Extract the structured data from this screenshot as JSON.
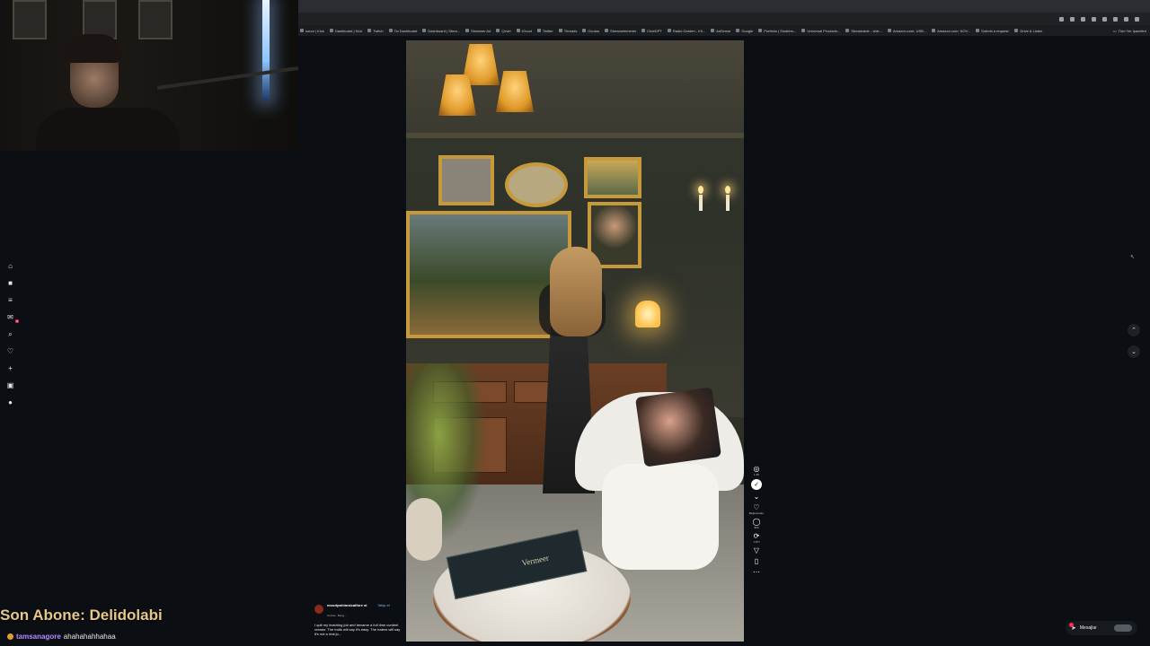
{
  "browser": {
    "bookmarks": [
      "sonor | Kick",
      "Dashboard | Kick",
      "Twitch",
      "Tw Dashboard",
      "Dashboard | Strea...",
      "Streamer Ad",
      "Çeviri",
      "iCloud",
      "Twitter",
      "Threads",
      "Ocutus",
      "Streamelements",
      "ChatGPT",
      "Radio Garden - Kli...",
      "AdSense",
      "Google",
      "Portfolio | Shutters...",
      "Universal Products...",
      "Streamable - vide...",
      "Amazon.com: USB...",
      "Amazon.com: KOV...",
      "Submit a request:",
      "Drive & Listen"
    ],
    "bookmarks_end": "Tüm Yer İşaretleri"
  },
  "sidebar": {
    "icons": [
      "home-icon",
      "following-icon",
      "list-icon",
      "inbox-icon",
      "search-icon",
      "heart-icon",
      "plus-icon",
      "message-icon",
      "profile-icon"
    ],
    "inbox_badge": "2"
  },
  "video": {
    "book_title": "Vermeer",
    "actions": [
      {
        "name": "coins",
        "value": "1.3K"
      },
      {
        "name": "likes",
        "value": "Beğenmeler"
      },
      {
        "name": "comments",
        "value": "904"
      },
      {
        "name": "reposts",
        "value": "1.977"
      }
    ]
  },
  "caption": {
    "username": "moodywhimsicalfore st",
    "follow": "Takip et",
    "music": "Cocina · Beng...",
    "text": "I quit my teaching job and became a full time content creator. The trolls will say it's easy. The haters will say it's not a real jo..."
  },
  "messages": {
    "label": "Mesajlar"
  },
  "overlay": {
    "last_sub": "Son Abone: Delidolabi",
    "chat_user": "tamsanagore",
    "chat_text": "ahahahahhahaa"
  }
}
